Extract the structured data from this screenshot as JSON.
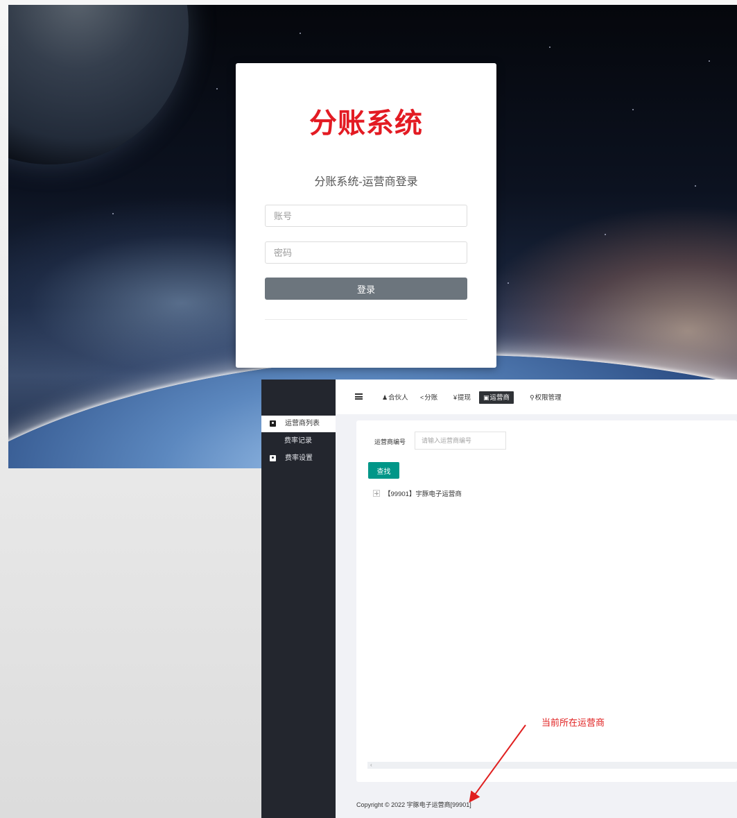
{
  "login": {
    "logo_text": "分账系统",
    "subtitle": "分账系统-运营商登录",
    "account_placeholder": "账号",
    "password_placeholder": "密码",
    "login_button": "登录"
  },
  "admin": {
    "sidebar": {
      "items": [
        {
          "label": "运营商列表",
          "icon": "user-card-icon",
          "active": true
        },
        {
          "label": "费率记录",
          "icon": "",
          "active": false
        },
        {
          "label": "费率设置",
          "icon": "user-card-icon",
          "active": false
        }
      ]
    },
    "topnav": {
      "items": [
        {
          "glyph": "♟",
          "label": "合伙人",
          "icon": "person-icon"
        },
        {
          "glyph": "<",
          "label": "分账",
          "icon": "share-icon"
        },
        {
          "glyph": "¥",
          "label": "提现",
          "icon": "yen-icon"
        },
        {
          "glyph": "▣",
          "label": "运营商",
          "icon": "user-card-icon",
          "active": true
        },
        {
          "glyph": "⚲",
          "label": "权限管理",
          "icon": "key-icon"
        }
      ]
    },
    "search": {
      "label": "运营商编号",
      "placeholder": "请输入运营商编号",
      "button": "查找"
    },
    "tree": {
      "rows": [
        {
          "text": "【99901】宇豚电子运营商"
        }
      ]
    },
    "footer": "Copyright © 2022 宇豚电子运营商[99901]"
  },
  "annotation": {
    "text": "当前所在运营商",
    "color": "#e02020"
  },
  "colors": {
    "logo": "#e31b23",
    "login_button": "#6c757d",
    "sidebar_bg": "#23262e",
    "find_button": "#009688"
  }
}
